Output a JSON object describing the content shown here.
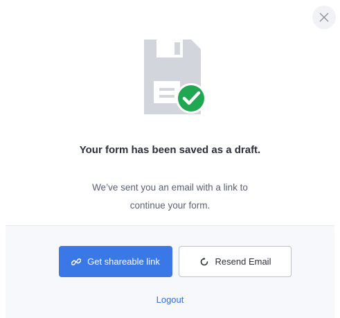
{
  "dialog": {
    "title": "Your form has been saved as a draft.",
    "message": "We’ve sent you an email with a link to continue your form."
  },
  "actions": {
    "share_label": "Get shareable link",
    "resend_label": "Resend Email",
    "logout_label": "Logout"
  },
  "icons": {
    "close": "close-icon",
    "illustration": "floppy-disk-icon",
    "check": "check-circle-icon",
    "share": "link-icon",
    "resend": "refresh-icon"
  },
  "colors": {
    "primary": "#3b78e7",
    "success": "#1fa752",
    "link": "#2f6fdb"
  }
}
